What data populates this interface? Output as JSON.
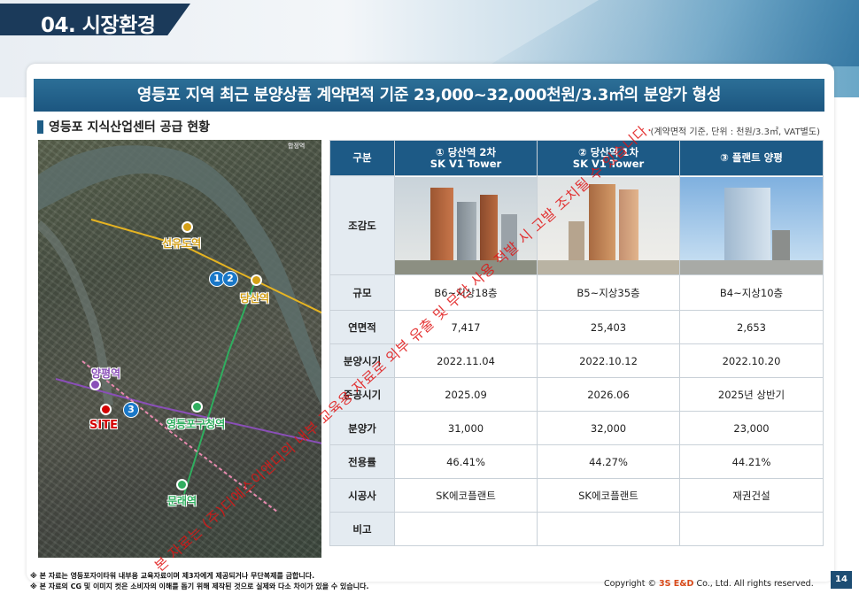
{
  "header": {
    "title": "04. 시장환경"
  },
  "banner": {
    "title": "영등포 지역 최근 분양상품 계약면적 기준 23,000~32,000천원/3.3㎡의 분양가 형성"
  },
  "section": {
    "title": "영등포 지식산업센터 공급 현황",
    "note": "(계약면적 기준, 단위 : 천원/3.3㎡, VAT별도)"
  },
  "map": {
    "stations": [
      {
        "name": "선유도역",
        "color": "#d4a017"
      },
      {
        "name": "당산역",
        "color": "#d4a017"
      },
      {
        "name": "양평역",
        "color": "#8a4fb8"
      },
      {
        "name": "영등포구청역",
        "color": "#2fae5f"
      },
      {
        "name": "문래역",
        "color": "#2fae5f"
      }
    ],
    "markers": [
      "1",
      "2",
      "3"
    ],
    "site_label": "SITE",
    "corner_text": "합정역"
  },
  "table": {
    "corner": "구분",
    "columns": [
      {
        "line1": "① 당산역 2차",
        "line2": "SK V1 Tower"
      },
      {
        "line1": "② 당산역 1차",
        "line2": "SK V1 Tower"
      },
      {
        "line1": "③ 플랜트 양평",
        "line2": ""
      }
    ],
    "image_row_label": "조감도",
    "rows": [
      {
        "label": "규모",
        "values": [
          "B6~지상18층",
          "B5~지상35층",
          "B4~지상10층"
        ]
      },
      {
        "label": "연면적",
        "values": [
          "7,417",
          "25,403",
          "2,653"
        ]
      },
      {
        "label": "분양시기",
        "values": [
          "2022.11.04",
          "2022.10.12",
          "2022.10.20"
        ]
      },
      {
        "label": "준공시기",
        "values": [
          "2025.09",
          "2026.06",
          "2025년 상반기"
        ]
      },
      {
        "label": "분양가",
        "values": [
          "31,000",
          "32,000",
          "23,000"
        ]
      },
      {
        "label": "전용률",
        "values": [
          "46.41%",
          "44.27%",
          "44.21%"
        ]
      },
      {
        "label": "시공사",
        "values": [
          "SK에코플랜트",
          "SK에코플랜트",
          "재권건설"
        ]
      },
      {
        "label": "비고",
        "values": [
          "",
          "",
          ""
        ]
      }
    ]
  },
  "footer": {
    "note1": "※ 본 자료는 영등포자이타워 내부용 교육자료이며 제3자에게 제공되거나 무단복제를 금합니다.",
    "note2": "※ 본 자료의 CG 및 이미지 컷은 소비자의 이해를 돕기 위해 제작된 것으로 실제와 다소 차이가 있을 수 있습니다.",
    "copyright_prefix": "Copyright ©",
    "brand": "3S E&D",
    "copyright_suffix": "Co., Ltd. All rights reserved.",
    "page": "14"
  },
  "watermark": "본 자료는 (주)디에스이앤디의 내부 교육용 자료로 외부 유출 및 무단 사용 적발 시 고발 조치될 수 있습니다."
}
